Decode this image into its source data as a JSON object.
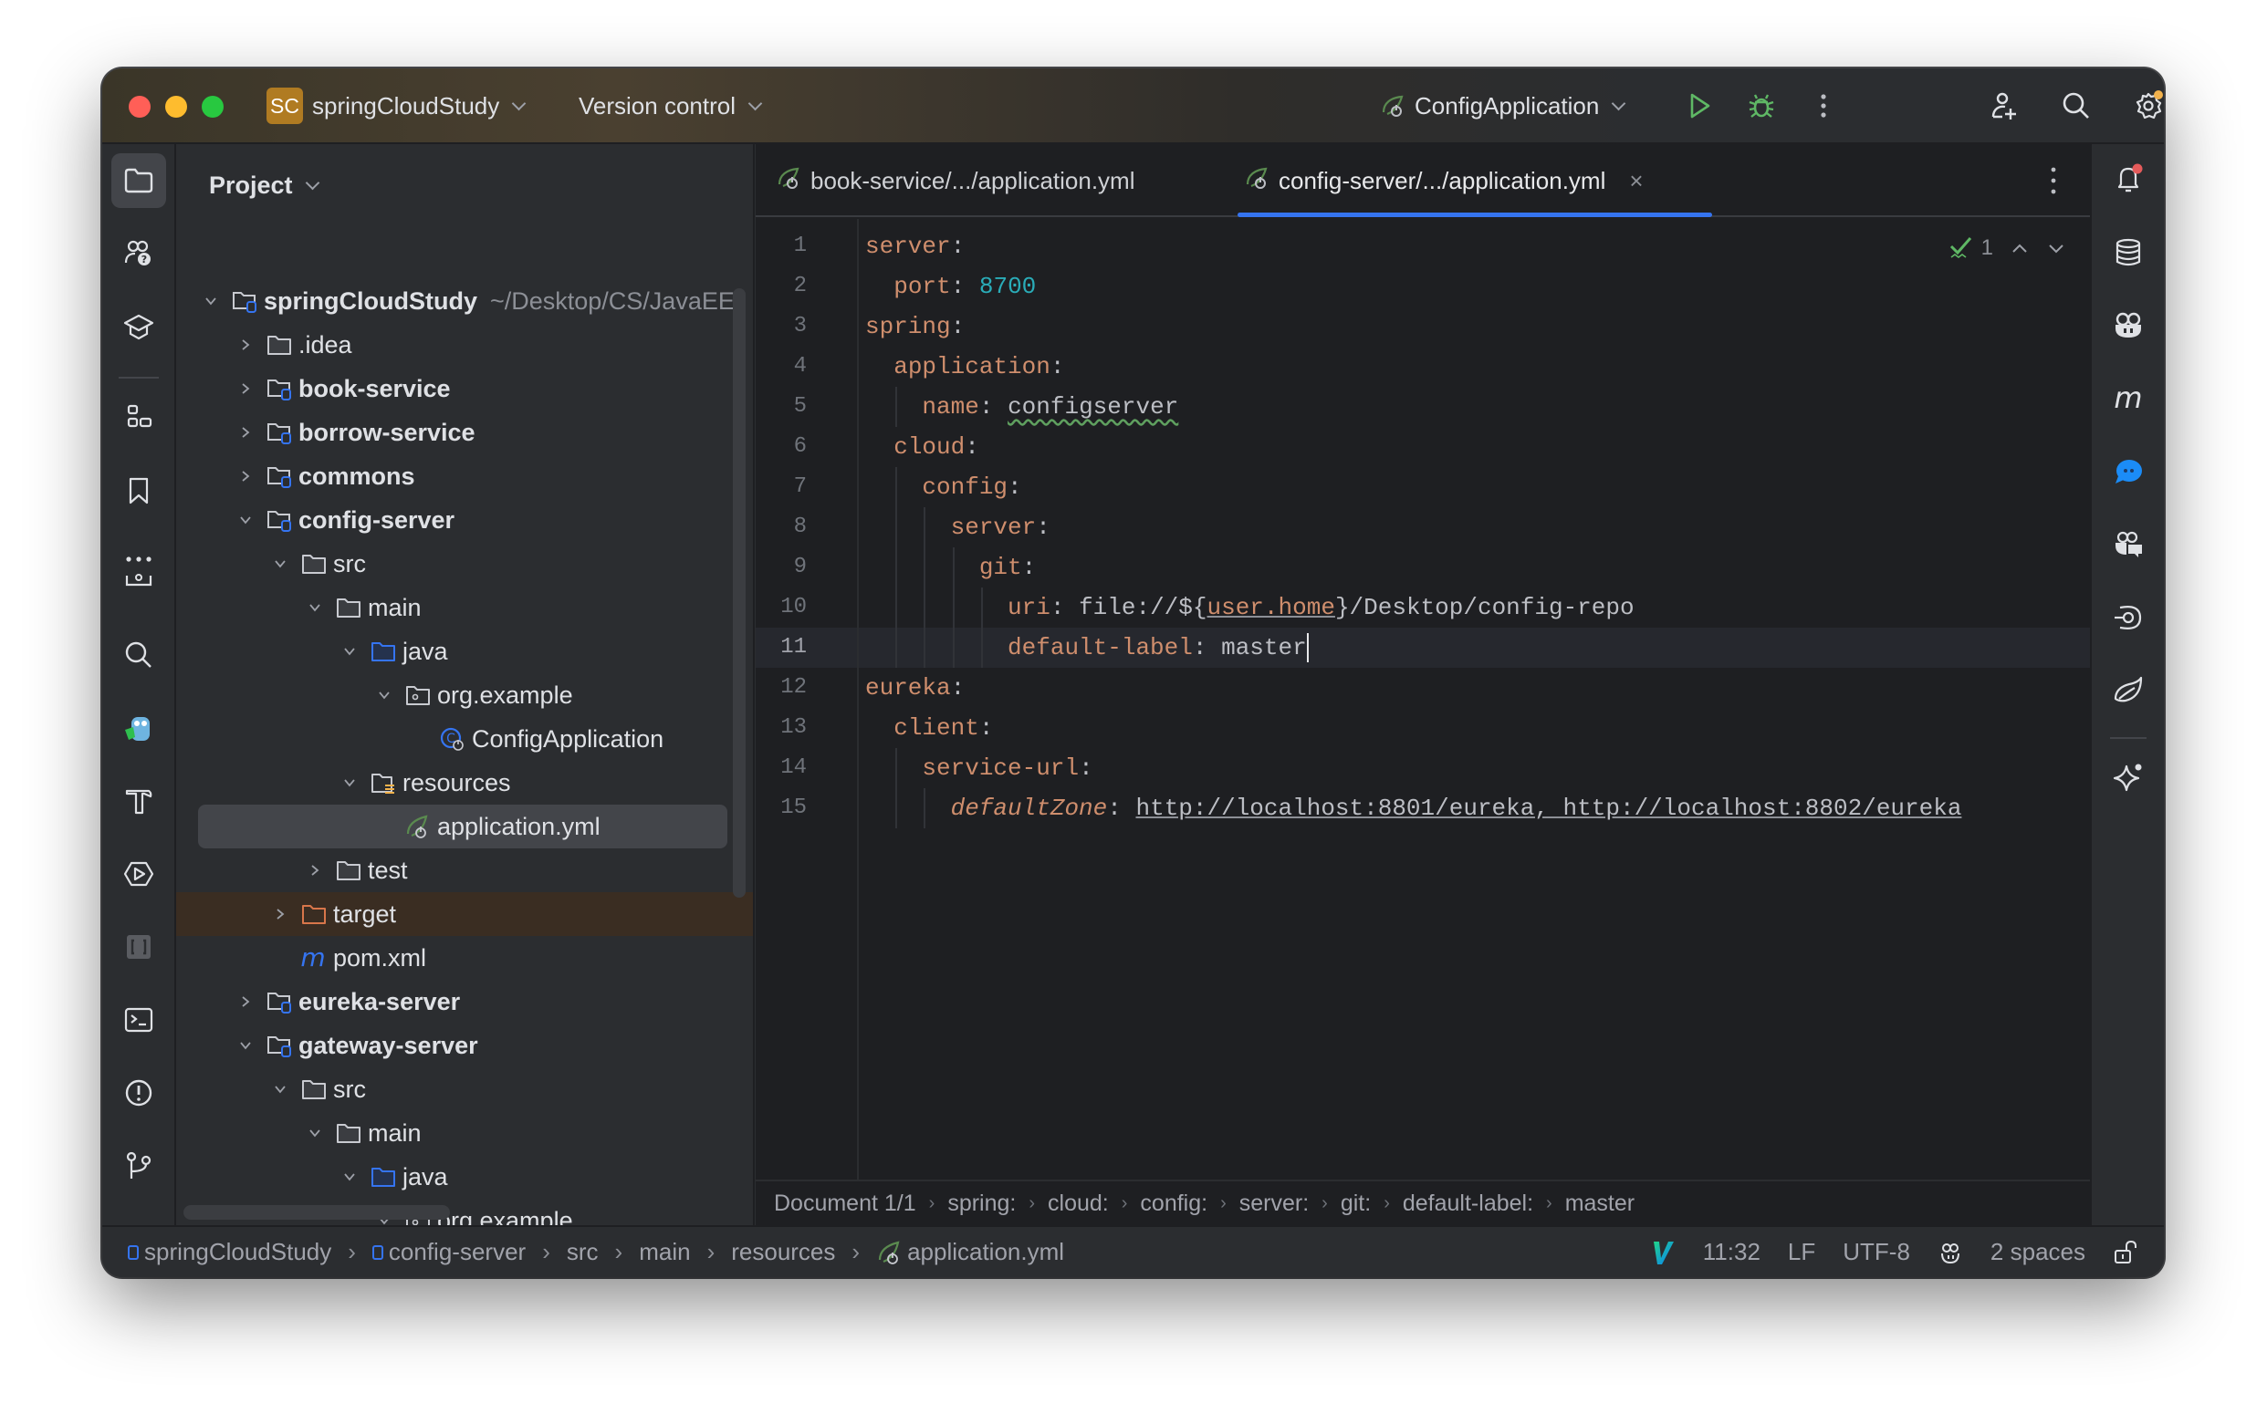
{
  "titlebar": {
    "project_badge": "SC",
    "project_name": "springCloudStudy",
    "vcs_label": "Version control",
    "run_config": "ConfigApplication",
    "icons": [
      "run-icon",
      "debug-icon",
      "more-icon",
      "add-user-icon",
      "search-icon",
      "settings-icon"
    ]
  },
  "left_strip": {
    "icons": [
      "project-icon",
      "help-icon",
      "learn-icon",
      "structure-icon",
      "bookmarks-icon",
      "more-tools-icon",
      "services-icon",
      "find-icon",
      "gopher-icon",
      "build-icon",
      "run-icon",
      "vcs-icon",
      "terminal-icon",
      "problems-icon",
      "git-icon"
    ]
  },
  "project_panel": {
    "title": "Project",
    "tree": [
      {
        "label": "springCloudStudy",
        "hint": "~/Desktop/CS/JavaEE",
        "depth": 0,
        "expanded": true,
        "icon": "module",
        "bold": true
      },
      {
        "label": ".idea",
        "depth": 1,
        "expanded": false,
        "icon": "folder"
      },
      {
        "label": "book-service",
        "depth": 1,
        "expanded": false,
        "icon": "module",
        "bold": true
      },
      {
        "label": "borrow-service",
        "depth": 1,
        "expanded": false,
        "icon": "module",
        "bold": true
      },
      {
        "label": "commons",
        "depth": 1,
        "expanded": false,
        "icon": "module",
        "bold": true
      },
      {
        "label": "config-server",
        "depth": 1,
        "expanded": true,
        "icon": "module",
        "bold": true
      },
      {
        "label": "src",
        "depth": 2,
        "expanded": true,
        "icon": "folder"
      },
      {
        "label": "main",
        "depth": 3,
        "expanded": true,
        "icon": "folder"
      },
      {
        "label": "java",
        "depth": 4,
        "expanded": true,
        "icon": "source-folder"
      },
      {
        "label": "org.example",
        "depth": 5,
        "expanded": true,
        "icon": "package"
      },
      {
        "label": "ConfigApplication",
        "depth": 6,
        "icon": "spring-class"
      },
      {
        "label": "resources",
        "depth": 4,
        "expanded": true,
        "icon": "resources-folder"
      },
      {
        "label": "application.yml",
        "depth": 5,
        "icon": "spring-yml",
        "selected": true
      },
      {
        "label": "test",
        "depth": 3,
        "expanded": false,
        "icon": "folder"
      },
      {
        "label": "target",
        "depth": 2,
        "expanded": false,
        "icon": "excluded-folder",
        "excluded": true
      },
      {
        "label": "pom.xml",
        "depth": 2,
        "icon": "maven"
      },
      {
        "label": "eureka-server",
        "depth": 1,
        "expanded": false,
        "icon": "module",
        "bold": true
      },
      {
        "label": "gateway-server",
        "depth": 1,
        "expanded": true,
        "icon": "module",
        "bold": true
      },
      {
        "label": "src",
        "depth": 2,
        "expanded": true,
        "icon": "folder"
      },
      {
        "label": "main",
        "depth": 3,
        "expanded": true,
        "icon": "folder"
      },
      {
        "label": "java",
        "depth": 4,
        "expanded": true,
        "icon": "source-folder"
      },
      {
        "label": "org.example",
        "depth": 5,
        "expanded": true,
        "icon": "package"
      }
    ]
  },
  "editor": {
    "tabs": [
      {
        "label": "book-service/.../application.yml",
        "active": false
      },
      {
        "label": "config-server/.../application.yml",
        "active": true,
        "close": "×"
      }
    ],
    "inspection_count": "1",
    "current_line": 11,
    "lines": [
      [
        {
          "t": "server",
          "c": "k"
        },
        {
          "t": ":",
          "c": "p"
        }
      ],
      [
        {
          "t": "  "
        },
        {
          "t": "port",
          "c": "k"
        },
        {
          "t": ": ",
          "c": "p"
        },
        {
          "t": "8700",
          "c": "n"
        }
      ],
      [
        {
          "t": "spring",
          "c": "k"
        },
        {
          "t": ":",
          "c": "p"
        }
      ],
      [
        {
          "t": "  "
        },
        {
          "t": "application",
          "c": "k"
        },
        {
          "t": ":",
          "c": "p"
        }
      ],
      [
        {
          "t": "    "
        },
        {
          "t": "name",
          "c": "k"
        },
        {
          "t": ": ",
          "c": "p"
        },
        {
          "t": "configserver",
          "c": "v typo"
        }
      ],
      [
        {
          "t": "  "
        },
        {
          "t": "cloud",
          "c": "k"
        },
        {
          "t": ":",
          "c": "p"
        }
      ],
      [
        {
          "t": "    "
        },
        {
          "t": "config",
          "c": "k"
        },
        {
          "t": ":",
          "c": "p"
        }
      ],
      [
        {
          "t": "      "
        },
        {
          "t": "server",
          "c": "k"
        },
        {
          "t": ":",
          "c": "p"
        }
      ],
      [
        {
          "t": "        "
        },
        {
          "t": "git",
          "c": "k"
        },
        {
          "t": ":",
          "c": "p"
        }
      ],
      [
        {
          "t": "          "
        },
        {
          "t": "uri",
          "c": "k"
        },
        {
          "t": ": ",
          "c": "p"
        },
        {
          "t": "file://${",
          "c": "v"
        },
        {
          "t": "user.home",
          "c": "k u"
        },
        {
          "t": "}/Desktop/config-repo",
          "c": "v"
        }
      ],
      [
        {
          "t": "          "
        },
        {
          "t": "default-label",
          "c": "k"
        },
        {
          "t": ": ",
          "c": "p"
        },
        {
          "t": "master",
          "c": "v"
        },
        {
          "t": "",
          "c": "cursor"
        }
      ],
      [
        {
          "t": "eureka",
          "c": "k"
        },
        {
          "t": ":",
          "c": "p"
        }
      ],
      [
        {
          "t": "  "
        },
        {
          "t": "client",
          "c": "k"
        },
        {
          "t": ":",
          "c": "p"
        }
      ],
      [
        {
          "t": "    "
        },
        {
          "t": "service-url",
          "c": "k"
        },
        {
          "t": ":",
          "c": "p"
        }
      ],
      [
        {
          "t": "      "
        },
        {
          "t": "defaultZone",
          "c": "ki"
        },
        {
          "t": ": ",
          "c": "p"
        },
        {
          "t": "http://localhost:8801/eureka, http://localhost:8802/eureka",
          "c": "v u"
        }
      ]
    ],
    "breadcrumb": [
      "Document 1/1",
      "spring:",
      "cloud:",
      "config:",
      "server:",
      "git:",
      "default-label:",
      "master"
    ]
  },
  "right_strip": {
    "icons": [
      "notifications-icon",
      "database-icon",
      "copilot-icon",
      "maven-icon",
      "chat-icon",
      "copilot-chat-icon",
      "endpoints-icon",
      "spring-icon",
      "ai-assistant-icon"
    ]
  },
  "statusbar": {
    "path": [
      "springCloudStudy",
      "config-server",
      "src",
      "main",
      "resources",
      "application.yml"
    ],
    "caret": "11:32",
    "line_sep": "LF",
    "encoding": "UTF-8",
    "indent": "2 spaces"
  },
  "colors": {
    "accent": "#3574f0",
    "keyword": "#cf8e6d",
    "number": "#2aacb8",
    "run_green": "#5fb865",
    "notification_dot": "#e55b5b",
    "settings_dot": "#f2b24c"
  }
}
